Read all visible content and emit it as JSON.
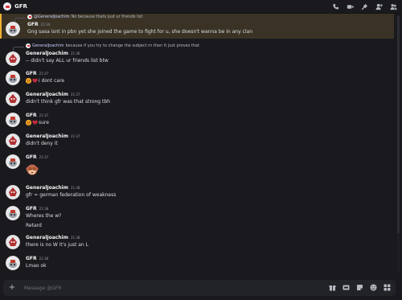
{
  "header": {
    "title": "GFR",
    "icons": [
      "call-icon",
      "video-icon",
      "pin-icon",
      "add-member-icon",
      "user-list-icon"
    ]
  },
  "colors": {
    "background": "#1a1a1e",
    "highlight": "#3a3325",
    "highlight_border": "#f0b232",
    "mention": "#c9cdfb"
  },
  "messages": [
    {
      "reply": {
        "name": "@GeneralJoachim",
        "text": "No because thats just ur friends list"
      },
      "author": "GFR",
      "time": "21:34",
      "lines": [
        "Gng sasa isnt in pbn yet she joined the game to fight for u, she doesn't wanna be in any clan"
      ]
    },
    {
      "reply": {
        "name": "GeneralJoachim",
        "text": "because if you try to change the subject rn then it just proves that"
      },
      "author": "GeneralJoachim",
      "time": "21:36",
      "lines": [
        "-- didn't say ALL ur friends list btw"
      ]
    },
    {
      "author": "GFR",
      "time": "21:37",
      "lines": [
        "i dont care"
      ]
    },
    {
      "author": "GeneralJoachim",
      "time": "21:37",
      "lines": [
        "didn't think gfr was that strong tbh"
      ]
    },
    {
      "author": "GFR",
      "time": "21:37",
      "lines": [
        "sure"
      ]
    },
    {
      "author": "GeneralJoachim",
      "time": "21:37",
      "lines": [
        "didn't deny it"
      ]
    },
    {
      "author": "GFR",
      "time": "21:37",
      "lines": []
    },
    {
      "author": "GeneralJoachim",
      "time": "21:38",
      "lines": [
        "gfr = german federation of weakness"
      ]
    },
    {
      "author": "GFR",
      "time": "21:38",
      "lines": [
        "Wheres the w?",
        "Retard"
      ]
    },
    {
      "author": "GeneralJoachim",
      "time": "21:38",
      "lines": [
        "there is no W it's just an L"
      ]
    },
    {
      "author": "GFR",
      "time": "21:38",
      "lines": [
        "Lmao ok"
      ]
    }
  ],
  "composer": {
    "placeholder": "Message @GFR",
    "icons": [
      "gift-icon",
      "gif-icon",
      "sticker-icon",
      "emoji-icon",
      "apps-icon"
    ]
  }
}
